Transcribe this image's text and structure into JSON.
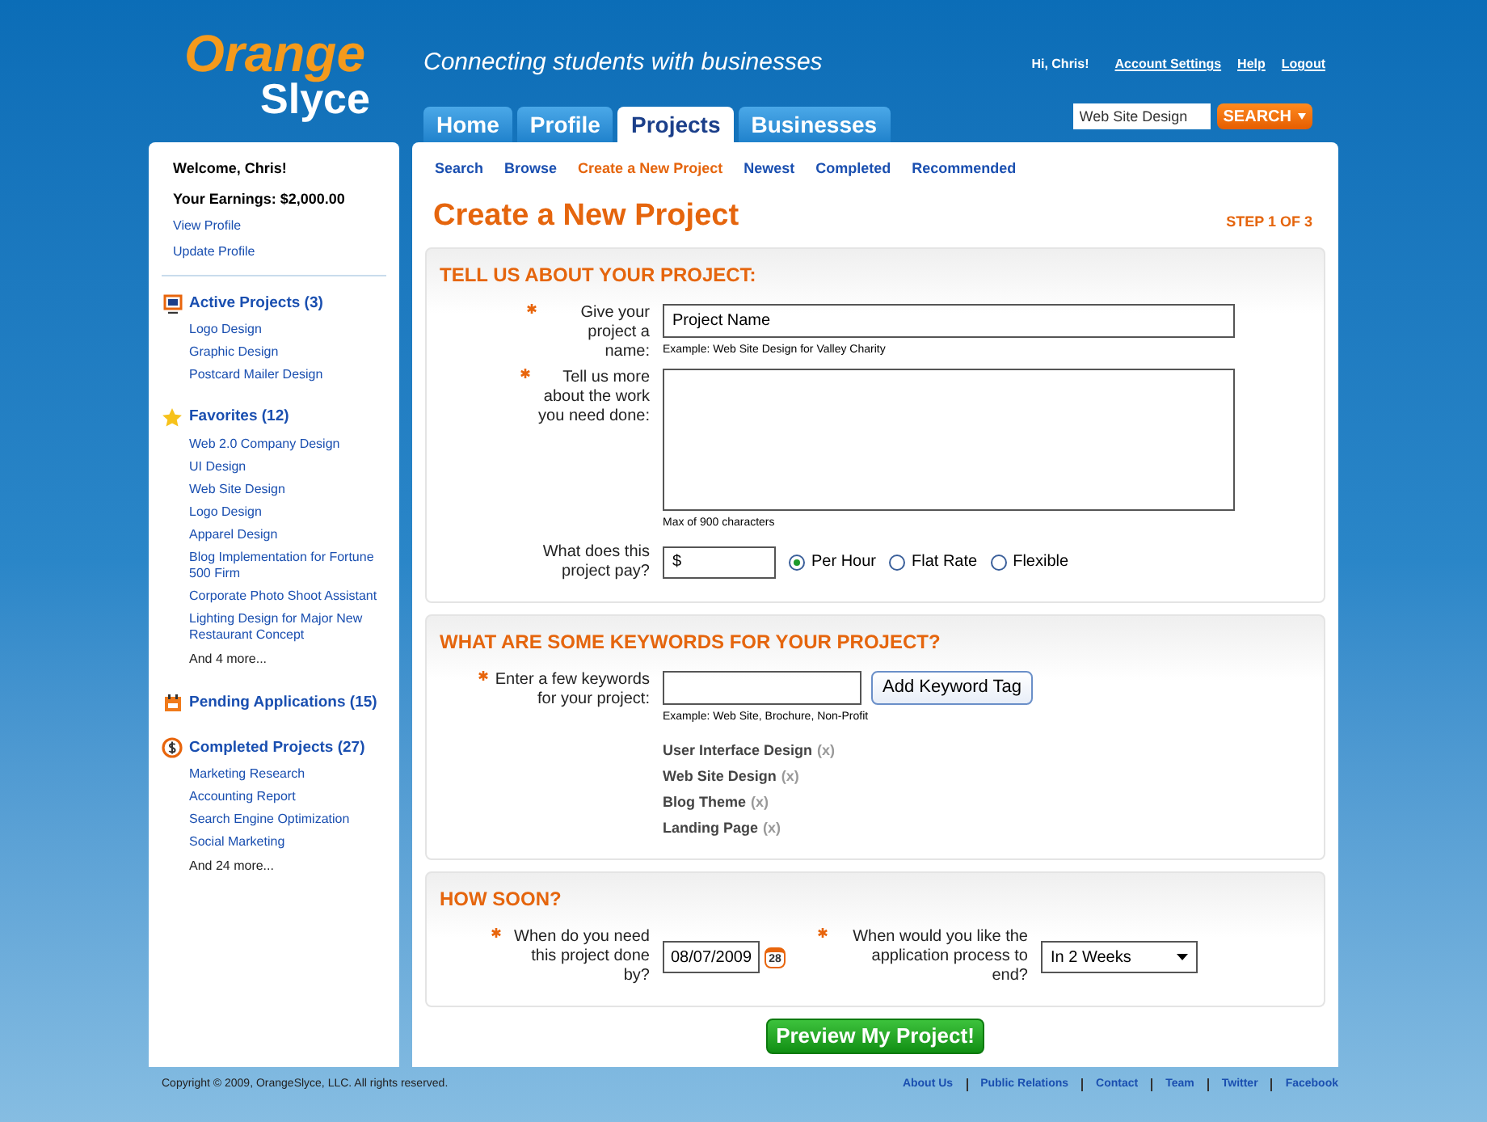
{
  "logo": {
    "line1": "Orange",
    "line2": "Slyce"
  },
  "tagline": "Connecting students with businesses",
  "user_links": [
    {
      "label": "Hi, Chris!",
      "kind": "text"
    },
    {
      "label": "Account Settings",
      "kind": "link"
    },
    {
      "label": "Help",
      "kind": "link"
    },
    {
      "label": "Logout",
      "kind": "link"
    }
  ],
  "tabs": [
    {
      "label": "Home",
      "selected": false
    },
    {
      "label": "Profile",
      "selected": false
    },
    {
      "label": "Projects",
      "selected": true
    },
    {
      "label": "Businesses",
      "selected": false
    }
  ],
  "search": {
    "value": "Web Site Design",
    "button": "SEARCH"
  },
  "sidebar": {
    "welcome": "Welcome, Chris!",
    "earnings": "Your Earnings: $2,000.00",
    "links": [
      "View Profile",
      "Update Profile"
    ],
    "sections": [
      {
        "title": "Active Projects (3)",
        "items": [
          "Logo Design",
          "Graphic Design",
          "Postcard Mailer Design"
        ]
      },
      {
        "title": "Favorites (12)",
        "items": [
          "Web 2.0 Company Design",
          "UI Design",
          "Web Site Design",
          "Logo Design",
          "Apparel Design",
          "Blog Implementation for Fortune 500 Firm",
          "Corporate Photo Shoot Assistant",
          "Lighting Design for Major New Restaurant Concept"
        ],
        "more": "And 4 more..."
      },
      {
        "title": "Pending Applications (15)"
      },
      {
        "title": "Completed Projects (27)",
        "items": [
          "Marketing Research",
          "Accounting Report",
          "Search Engine Optimization",
          "Social Marketing"
        ],
        "more": "And 24 more..."
      }
    ]
  },
  "subnav": [
    {
      "label": "Search",
      "selected": false
    },
    {
      "label": "Browse",
      "selected": false
    },
    {
      "label": "Create a New Project",
      "selected": true
    },
    {
      "label": "Newest",
      "selected": false
    },
    {
      "label": "Completed",
      "selected": false
    },
    {
      "label": "Recommended",
      "selected": false
    }
  ],
  "page_title": "Create a New Project",
  "step": "STEP 1 OF 3",
  "about": {
    "heading": "TELL US ABOUT YOUR PROJECT:",
    "name_field": {
      "label": "Give your project a name:",
      "required": true,
      "value": "Project Name",
      "hint": "Example: Web Site Design for Valley Charity"
    },
    "description_field": {
      "label": "Tell us more about the work you need done:",
      "required": true,
      "hint": "Max of 900 characters"
    },
    "pay_field": {
      "label": "What does this project pay?",
      "required": false,
      "value": "$",
      "options": [
        {
          "label": "Per Hour",
          "selected": true
        },
        {
          "label": "Flat Rate",
          "selected": false
        },
        {
          "label": "Flexible",
          "selected": false
        }
      ]
    }
  },
  "keywords": {
    "heading": "WHAT ARE SOME KEYWORDS FOR YOUR PROJECT?",
    "label": "Enter a few keywords for your project:",
    "required": true,
    "button": "Add Keyword Tag",
    "hint": "Example: Web Site, Brochure, Non-Profit",
    "tags": [
      {
        "label": "User Interface Design",
        "remove": "(x)"
      },
      {
        "label": "Web Site Design",
        "remove": "(x)"
      },
      {
        "label": "Blog Theme",
        "remove": "(x)"
      },
      {
        "label": "Landing Page",
        "remove": "(x)"
      }
    ]
  },
  "timing": {
    "heading": "HOW SOON?",
    "date_field": {
      "label": "When do you need this project done by?",
      "required": true,
      "value": "08/07/2009",
      "calendar_day": "28"
    },
    "end_field": {
      "label": "When would you like the application process to end?",
      "required": true,
      "value": "In 2 Weeks"
    }
  },
  "preview_button": "Preview My Project!",
  "footer": {
    "copyright": "Copyright © 2009, OrangeSlyce, LLC. All rights reserved.",
    "links": [
      "About Us",
      "Public Relations",
      "Contact",
      "Team",
      "Twitter",
      "Facebook"
    ]
  }
}
